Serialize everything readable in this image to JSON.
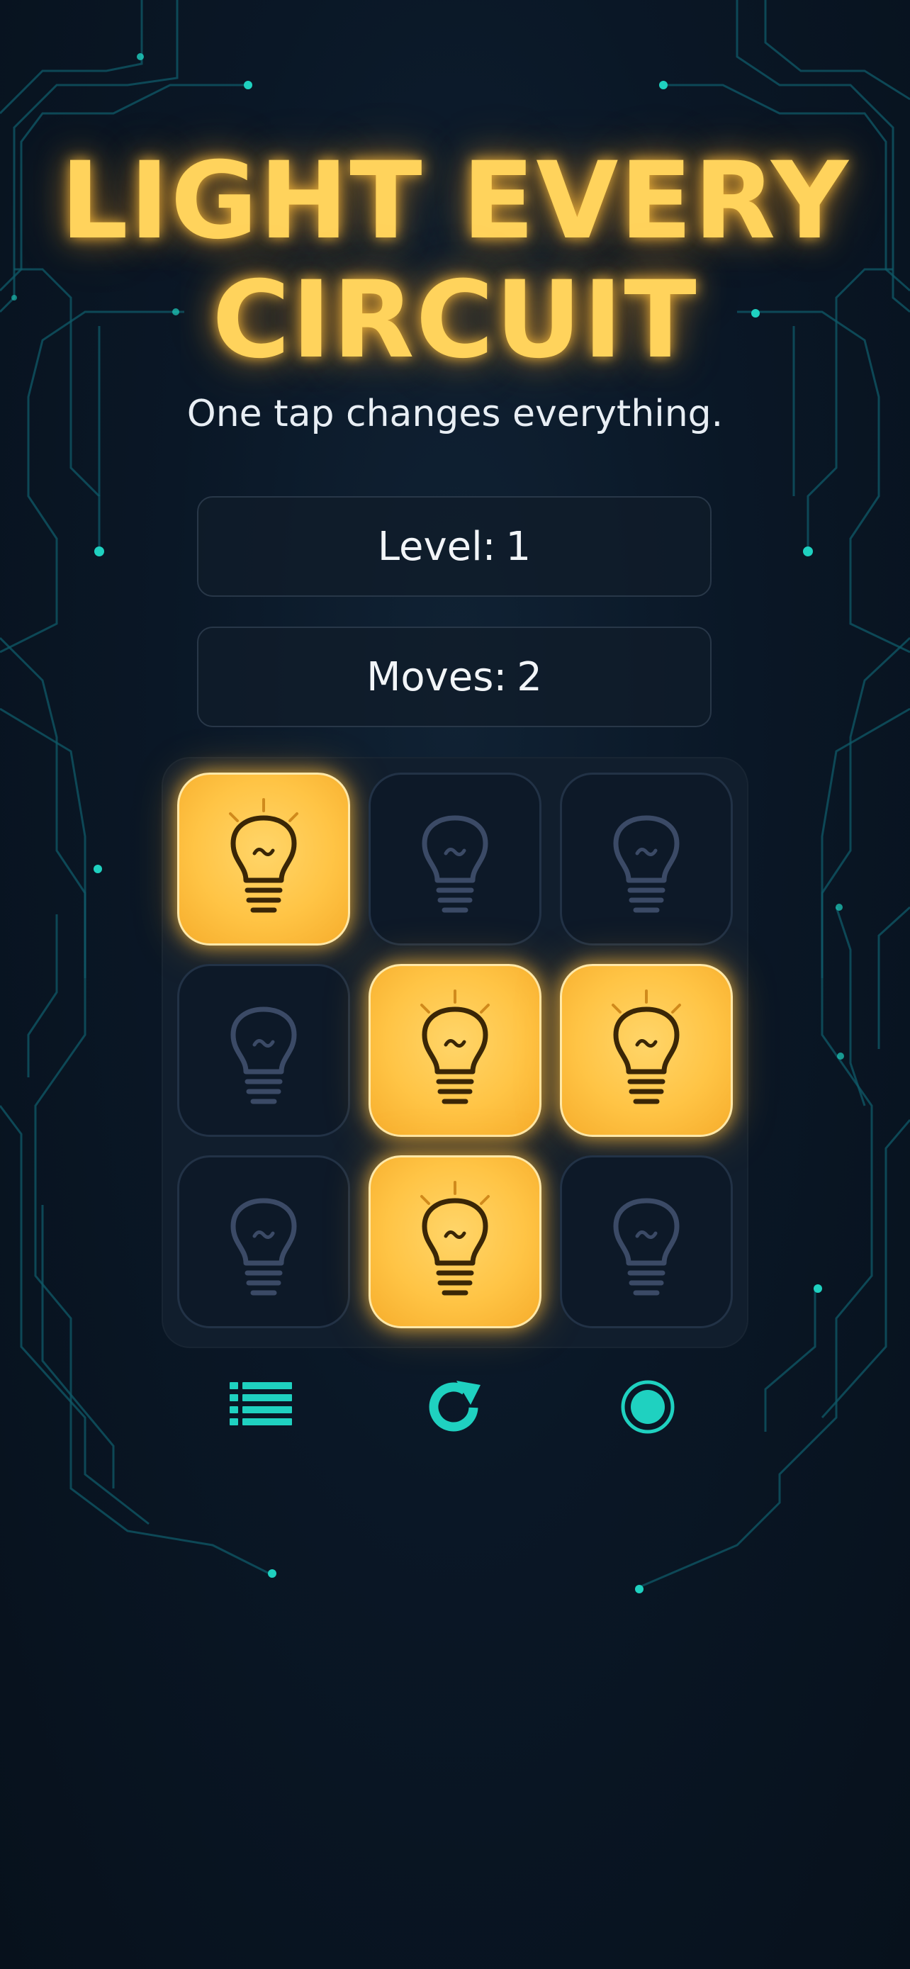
{
  "title": {
    "line1": "LIGHT EVERY",
    "line2": "CIRCUIT"
  },
  "subtitle": "One tap changes everything.",
  "stats": {
    "level_label": "Level:",
    "level_value": "1",
    "moves_label": "Moves:",
    "moves_value": "2"
  },
  "board": {
    "rows": 3,
    "cols": 3,
    "cells": [
      {
        "row": 1,
        "col": 1,
        "lit": true
      },
      {
        "row": 1,
        "col": 2,
        "lit": false
      },
      {
        "row": 1,
        "col": 3,
        "lit": false
      },
      {
        "row": 2,
        "col": 1,
        "lit": false
      },
      {
        "row": 2,
        "col": 2,
        "lit": true
      },
      {
        "row": 2,
        "col": 3,
        "lit": true
      },
      {
        "row": 3,
        "col": 1,
        "lit": false
      },
      {
        "row": 3,
        "col": 2,
        "lit": true
      },
      {
        "row": 3,
        "col": 3,
        "lit": false
      }
    ],
    "cell_icon": "lightbulb-icon"
  },
  "controls": [
    {
      "name": "level-list-button",
      "icon": "list-icon"
    },
    {
      "name": "restart-button",
      "icon": "restart-icon"
    },
    {
      "name": "record-button",
      "icon": "record-icon"
    }
  ],
  "colors": {
    "background": "#08131f",
    "title_glow": "#ffd35c",
    "lit_tile": "#ffc445",
    "unlit_tile": "#0d1928",
    "accent_teal": "#1fd1c0",
    "circuit_lines": "#0f5e6a"
  }
}
